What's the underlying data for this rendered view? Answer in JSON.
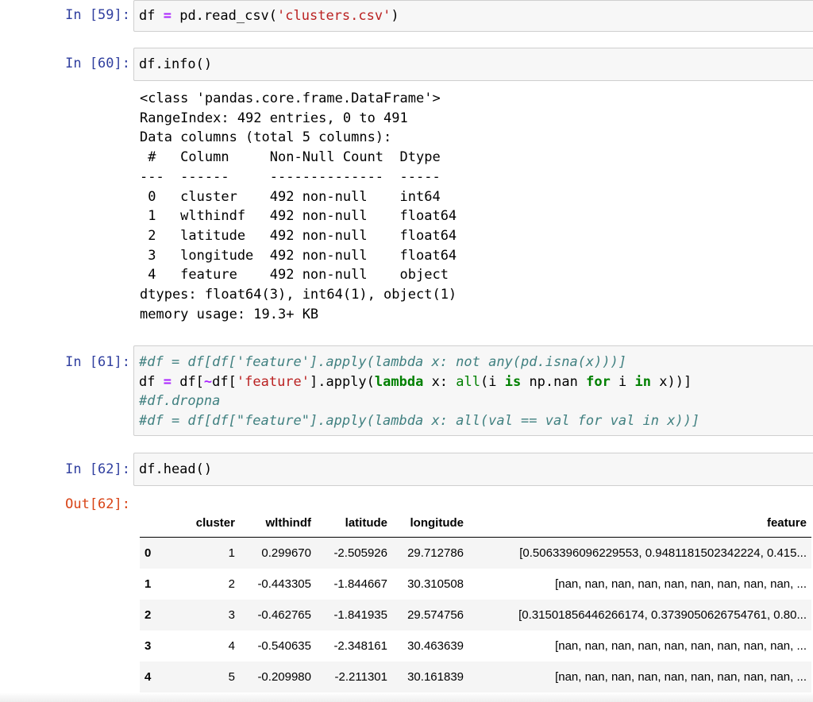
{
  "cells": [
    {
      "prompt": "In [59]:",
      "code": [
        [
          "df ",
          "="
        ],
        [
          " pd.read_csv(",
          "'clusters.csv'",
          ")"
        ]
      ]
    },
    {
      "prompt": "In [60]:",
      "code_text": "df.info()"
    },
    {
      "prompt": "In [61]:"
    },
    {
      "prompt": "In [62]:",
      "code_text": "df.head()"
    }
  ],
  "c59": {
    "a": "df ",
    "op": "=",
    "b": " pd.read_csv(",
    "s": "'clusters.csv'",
    "c": ")"
  },
  "c61": {
    "l1": "#df = df[df['feature'].apply(lambda x: not any(pd.isna(x)))]",
    "l2": {
      "a": "df ",
      "op": "=",
      "b": " df[",
      "t": "~",
      "c": "df[",
      "s": "'feature'",
      "d": "].apply(",
      "k1": "lambda",
      "e": " x: ",
      "k2": "all",
      "f": "(i ",
      "k3": "is",
      "g": " np.nan ",
      "k4": "for",
      "h": " i ",
      "k5": "in",
      "i": " x))]"
    },
    "l3": "#df.dropna",
    "l4": "#df = df[df[\"feature\"].apply(lambda x: all(val == val for val in x))]"
  },
  "stdout": "<class 'pandas.core.frame.DataFrame'>\nRangeIndex: 492 entries, 0 to 491\nData columns (total 5 columns):\n #   Column     Non-Null Count  Dtype  \n---  ------     --------------  -----  \n 0   cluster    492 non-null    int64  \n 1   wlthindf   492 non-null    float64\n 2   latitude   492 non-null    float64\n 3   longitude  492 non-null    float64\n 4   feature    492 non-null    object \ndtypes: float64(3), int64(1), object(1)\nmemory usage: 19.3+ KB",
  "out_prompt": "Out[62]:",
  "table": {
    "columns": [
      "",
      "cluster",
      "wlthindf",
      "latitude",
      "longitude",
      "feature"
    ],
    "rows": [
      [
        "0",
        "1",
        "0.299670",
        "-2.505926",
        "29.712786",
        "[0.5063396096229553, 0.9481181502342224, 0.415..."
      ],
      [
        "1",
        "2",
        "-0.443305",
        "-1.844667",
        "30.310508",
        "[nan, nan, nan, nan, nan, nan, nan, nan, nan, ..."
      ],
      [
        "2",
        "3",
        "-0.462765",
        "-1.841935",
        "29.574756",
        "[0.31501856446266174, 0.3739050626754761, 0.80..."
      ],
      [
        "3",
        "4",
        "-0.540635",
        "-2.348161",
        "30.463639",
        "[nan, nan, nan, nan, nan, nan, nan, nan, nan, ..."
      ],
      [
        "4",
        "5",
        "-0.209980",
        "-2.211301",
        "30.161839",
        "[nan, nan, nan, nan, nan, nan, nan, nan, nan, ..."
      ]
    ]
  },
  "colors": {
    "prompt_in": "#303f9f",
    "prompt_out": "#d84315",
    "string": "#ba2121",
    "keyword": "#008000",
    "comment": "#408080",
    "operator": "#aa22ff"
  }
}
